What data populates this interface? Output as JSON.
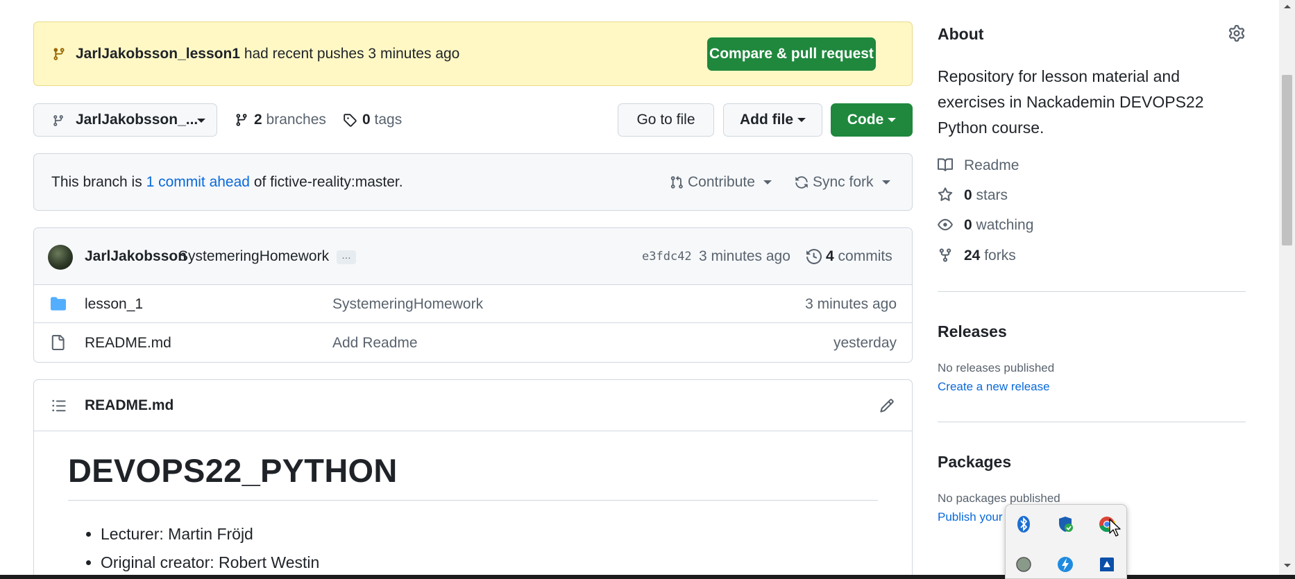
{
  "banner": {
    "branch": "JarlJakobsson_lesson1",
    "message": "had recent pushes 3 minutes ago",
    "button": "Compare & pull request"
  },
  "toolbar": {
    "branch_label": "JarlJakobsson_...",
    "branches_count": "2",
    "branches_label": "branches",
    "tags_count": "0",
    "tags_label": "tags",
    "go_to_file": "Go to file",
    "add_file": "Add file",
    "code": "Code"
  },
  "ahead": {
    "prefix": "This branch is",
    "link": "1 commit ahead",
    "suffix": "of fictive-reality:master.",
    "contribute": "Contribute",
    "sync_fork": "Sync fork"
  },
  "latest_commit": {
    "author": "JarlJakobsson",
    "message": "SystemeringHomework",
    "ellipsis": "…",
    "sha": "e3fdc42",
    "time": "3 minutes ago",
    "commits_count": "4",
    "commits_label": "commits"
  },
  "files": [
    {
      "type": "folder",
      "name": "lesson_1",
      "message": "SystemeringHomework",
      "time": "3 minutes ago"
    },
    {
      "type": "file",
      "name": "README.md",
      "message": "Add Readme",
      "time": "yesterday"
    }
  ],
  "readme": {
    "filename": "README.md",
    "heading": "DEVOPS22_PYTHON",
    "items": [
      "Lecturer: Martin Fröjd",
      "Original creator: Robert Westin"
    ]
  },
  "about": {
    "title": "About",
    "description": "Repository for lesson material and exercises in Nackademin DEVOPS22 Python course.",
    "readme": "Readme",
    "stars_count": "0",
    "stars_label": "stars",
    "watching_count": "0",
    "watching_label": "watching",
    "forks_count": "24",
    "forks_label": "forks"
  },
  "releases": {
    "title": "Releases",
    "empty": "No releases published",
    "link": "Create a new release"
  },
  "packages": {
    "title": "Packages",
    "empty": "No packages published",
    "link": "Publish your"
  },
  "tray_icons": [
    "bluetooth-icon",
    "windows-security-icon",
    "chrome-icon",
    "status-dot-icon",
    "lightning-app-icon",
    "blue-app-icon"
  ]
}
